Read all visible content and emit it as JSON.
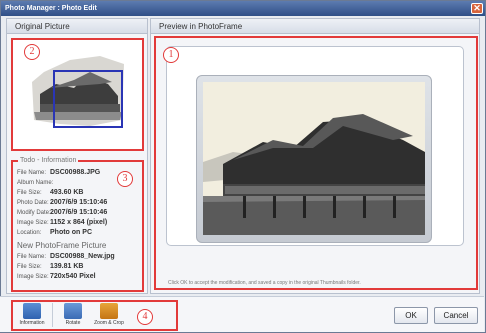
{
  "window": {
    "title": "Photo Manager : Photo Edit",
    "close_glyph": "✕"
  },
  "left_panel": {
    "header": "Original Picture"
  },
  "right_panel": {
    "header": "Preview in PhotoFrame"
  },
  "info": {
    "legend": "Todo - Information",
    "original": [
      {
        "label": "File Name:",
        "value": "DSC00988.JPG"
      },
      {
        "label": "Album Name:",
        "value": ""
      },
      {
        "label": "File Size:",
        "value": "493.60 KB"
      },
      {
        "label": "Photo Date:",
        "value": "2007/6/9 15:10:46"
      },
      {
        "label": "Modify Date:",
        "value": "2007/6/9 15:10:46"
      },
      {
        "label": "Image Size:",
        "value": "1152 x 864 (pixel)"
      },
      {
        "label": "Location:",
        "value": "Photo on PC"
      }
    ],
    "new_section_title": "New PhotoFrame Picture",
    "new": [
      {
        "label": "File Name:",
        "value": "DSC00988_New.jpg"
      },
      {
        "label": "File Size:",
        "value": "139.81 KB"
      },
      {
        "label": "Image Size:",
        "value": "720x540 Pixel"
      }
    ]
  },
  "hint": "Click OK to accept the modification, and saved a copy in the original Thumbnails folder.",
  "tools": {
    "information": "Information",
    "rotate": "Rotate",
    "zoom_crop": "Zoom & Crop"
  },
  "buttons": {
    "ok": "OK",
    "cancel": "Cancel"
  },
  "callouts": {
    "one": "1",
    "two": "2",
    "three": "3",
    "four": "4"
  },
  "colors": {
    "callout_red": "#e23a3a",
    "selection_blue": "#2a35b5",
    "title_bar": "#2f4f87"
  },
  "icons": [
    "close-icon",
    "information-icon",
    "rotate-icon",
    "zoom-crop-icon"
  ]
}
